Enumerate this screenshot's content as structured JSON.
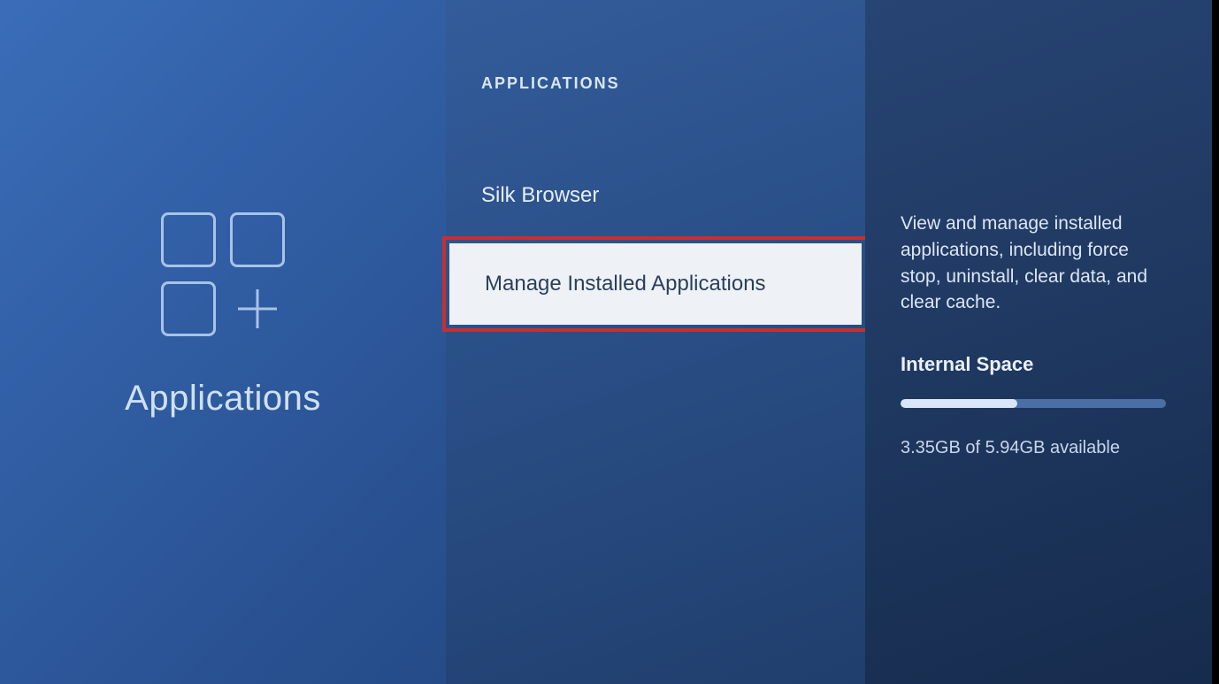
{
  "left": {
    "title": "Applications"
  },
  "middle": {
    "header": "APPLICATIONS",
    "items": [
      {
        "label": "Silk Browser",
        "selected": false
      },
      {
        "label": "Manage Installed Applications",
        "selected": true
      }
    ]
  },
  "right": {
    "description": "View and manage installed applications, including force stop, uninstall, clear data, and clear cache.",
    "storage_title": "Internal Space",
    "storage_used_gb": 3.35,
    "storage_total_gb": 5.94,
    "storage_text": "3.35GB of 5.94GB available",
    "progress_percent": 44
  }
}
